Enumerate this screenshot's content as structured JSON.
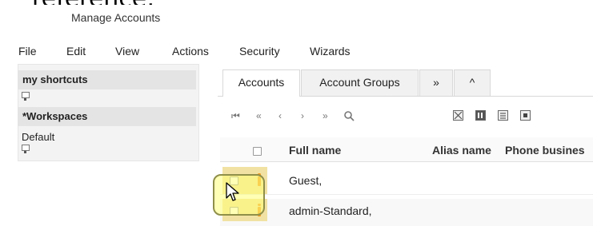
{
  "overlay": {
    "top_text": "reference:"
  },
  "window": {
    "title": "Manage Accounts"
  },
  "menu": [
    {
      "label": "File"
    },
    {
      "label": "Edit"
    },
    {
      "label": "View"
    },
    {
      "label": "Actions"
    },
    {
      "label": "Security"
    },
    {
      "label": "Wizards"
    }
  ],
  "left_panel": {
    "shortcuts_header": "my shortcuts",
    "workspaces_header": "*Workspaces",
    "workspace_item": "Default"
  },
  "tabs": [
    {
      "label": "Accounts",
      "active": true
    },
    {
      "label": "Account Groups",
      "active": false
    },
    {
      "label": "»",
      "active": false
    },
    {
      "label": "^",
      "active": false
    }
  ],
  "toolbar": {
    "nav_icons": [
      "first-page-icon",
      "prev-fast-icon",
      "prev-icon",
      "next-icon",
      "last-page-icon",
      "search-icon"
    ],
    "view_icons": [
      "close-view-icon",
      "column-view-icon",
      "list-view-icon",
      "expand-view-icon"
    ]
  },
  "table": {
    "columns": [
      "Full name",
      "Alias name",
      "Phone busines"
    ],
    "rows": [
      {
        "full_name": "Guest,"
      },
      {
        "full_name": "admin-Standard,"
      }
    ]
  },
  "colors": {
    "highlight": "#f1e2a3",
    "info_icon": "#f19a1f"
  }
}
